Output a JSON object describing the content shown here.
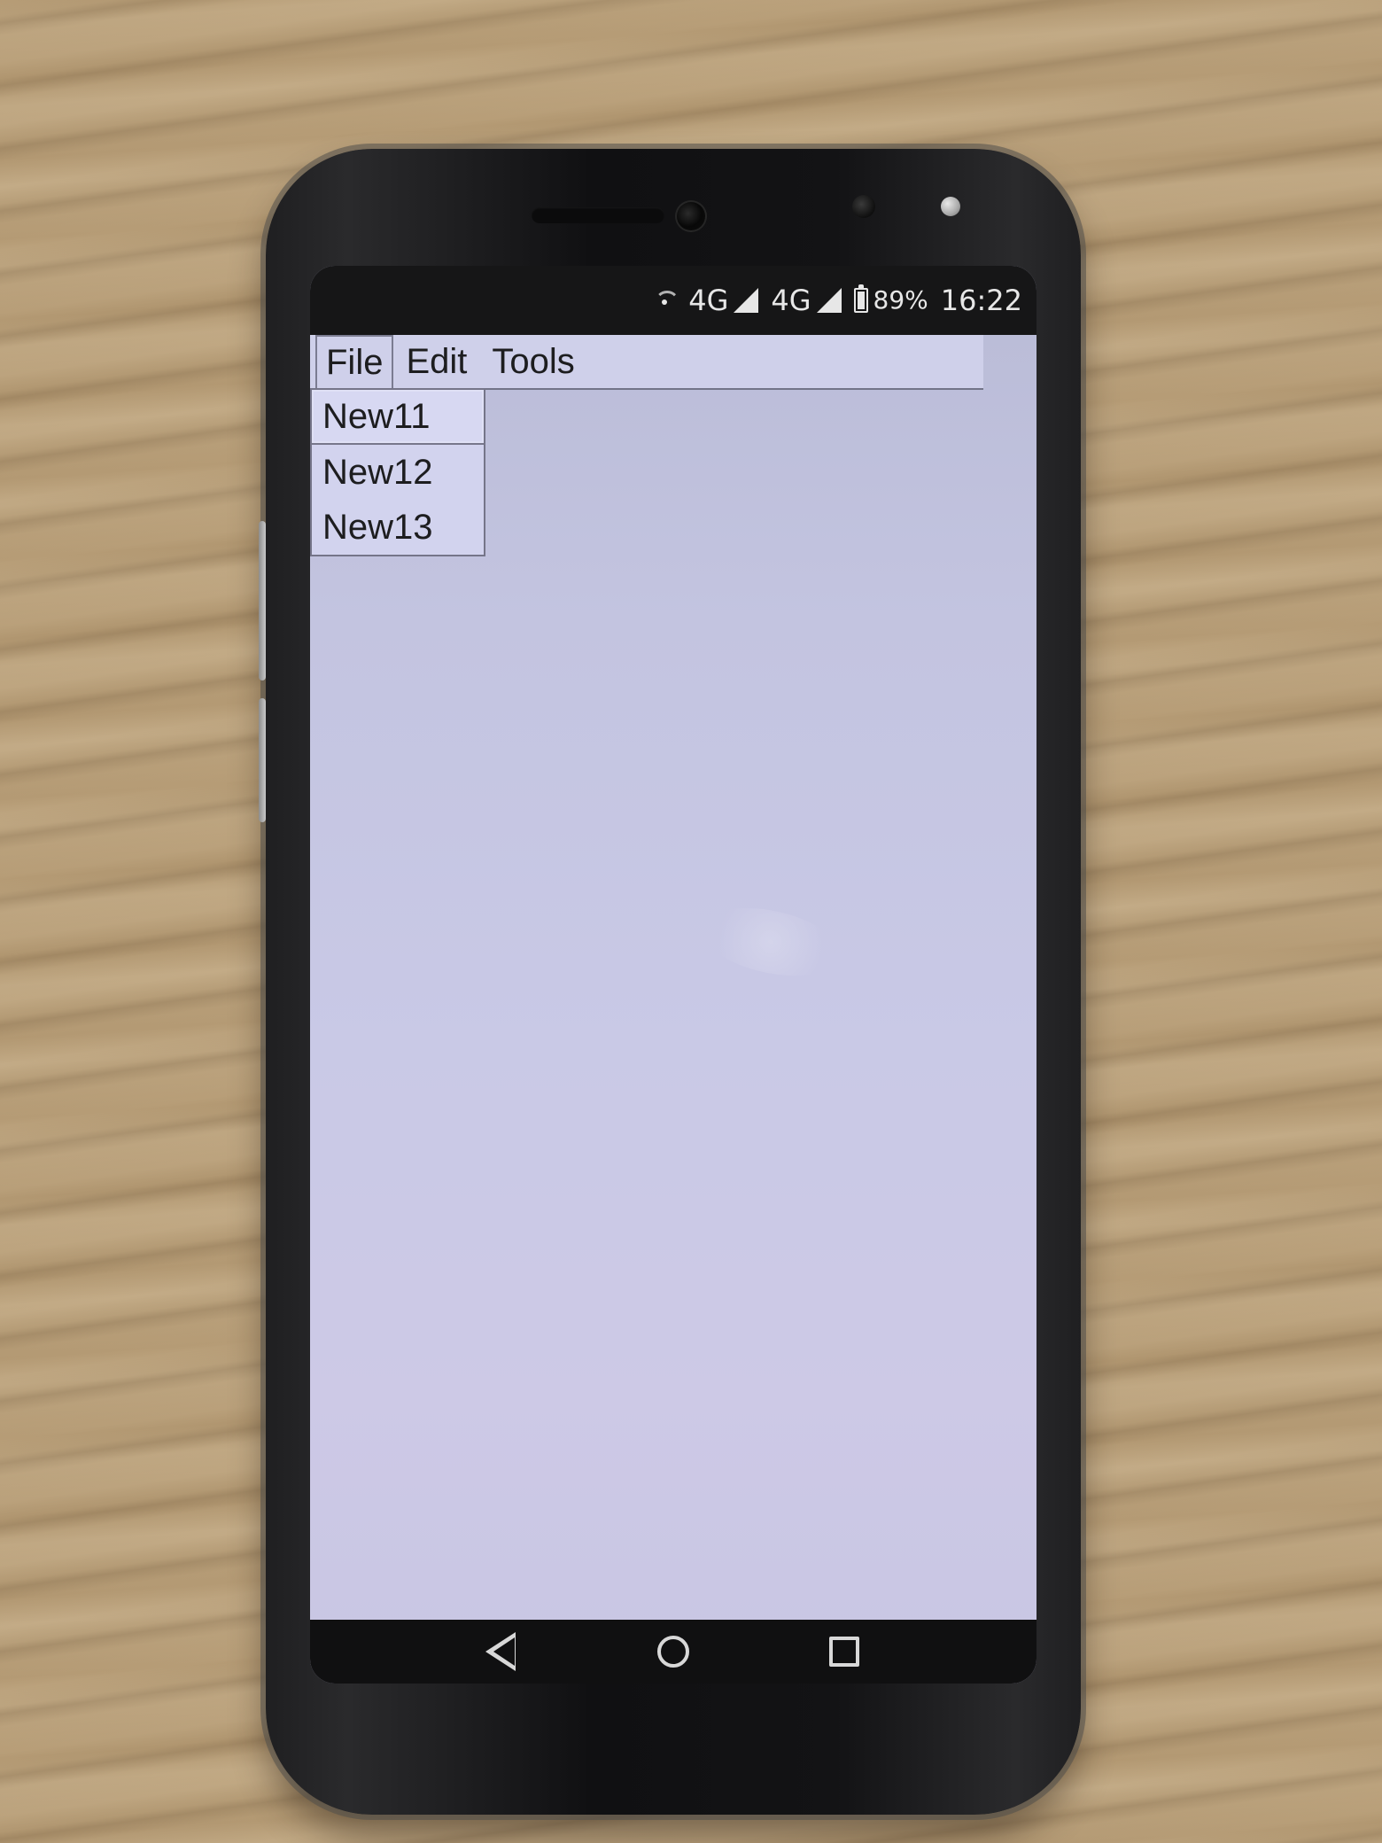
{
  "status_bar": {
    "network_1": "4G",
    "network_2": "4G",
    "battery_percent": "89%",
    "time": "16:22",
    "icons": {
      "wifi": "wifi-icon",
      "signal": "signal-strength-icon",
      "battery": "battery-icon"
    }
  },
  "app": {
    "menu": {
      "items": [
        {
          "label": "File"
        },
        {
          "label": "Edit"
        },
        {
          "label": "Tools"
        }
      ],
      "open_menu": "File",
      "dropdown": {
        "items": [
          {
            "label": "New11"
          },
          {
            "label": "New12"
          },
          {
            "label": "New13"
          }
        ],
        "highlighted_index": 0
      }
    }
  },
  "android_nav": {
    "icons": {
      "back": "back-icon",
      "home": "home-icon",
      "recent": "recent-apps-icon"
    }
  }
}
